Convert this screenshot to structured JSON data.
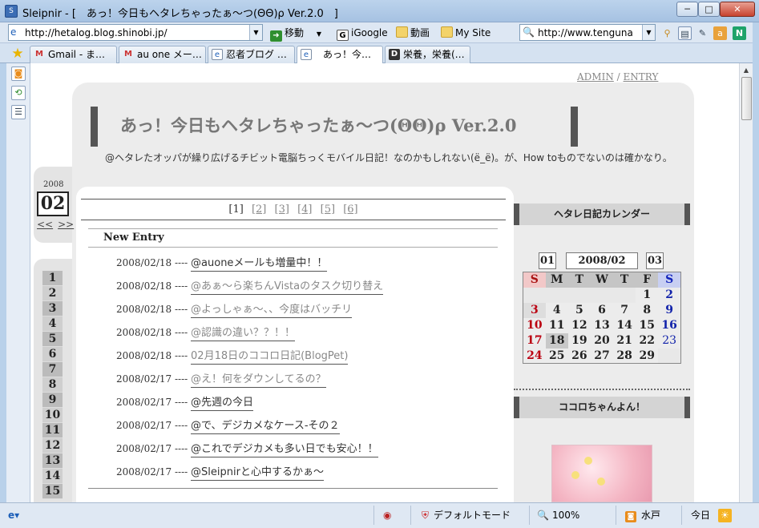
{
  "window": {
    "title": "Sleipnir - [　あっ！今日もヘタレちゃったぁ～つ(ΘΘ)ρ Ver.2.0　]",
    "min": "─",
    "max": "□",
    "close": "✕"
  },
  "toolbar": {
    "address": "http://hetalog.blog.shinobi.jp/",
    "go_label": "移動",
    "bookmarks": [
      "iGoogle",
      "動画",
      "My Site"
    ],
    "search_value": "http://www.tenguna"
  },
  "tabs": [
    {
      "label": "Gmail - ま…",
      "icon": "gmail-icon"
    },
    {
      "label": "au one メー…",
      "icon": "page-icon"
    },
    {
      "label": "忍者ブログ …",
      "icon": "page-icon"
    },
    {
      "label": "あっ！今…",
      "icon": "page-icon",
      "active": true
    },
    {
      "label": "栄養，栄養(…",
      "icon": "d-icon"
    }
  ],
  "page": {
    "admin": "ADMIN",
    "slash": "/",
    "entry": "ENTRY",
    "blog_title": "あっ！今日もヘタレちゃったぁ～つ(ΘΘ)ρ Ver.2.0",
    "blog_desc": "@ヘタレたオッパが繰り広げるチビット電脳ちっくモバイル日記！なのかもしれない(ё_ё)。が、How toものでないのは確かなり。",
    "date_year": "2008",
    "date_month": "02",
    "date_prev": "<<",
    "date_next": ">>",
    "days": [
      "1",
      "2",
      "3",
      "4",
      "5",
      "6",
      "7",
      "8",
      "9",
      "10",
      "11",
      "12",
      "13",
      "14",
      "15"
    ],
    "pager": [
      "[1]",
      "[2]",
      "[3]",
      "[4]",
      "[5]",
      "[6]"
    ],
    "new_entry_label": "New Entry",
    "entries": [
      {
        "date": "2008/02/18 ----",
        "title": "@auoneメールも増量中！！",
        "gray": false
      },
      {
        "date": "2008/02/18 ----",
        "title": "@あぁ～ら楽ちんVistaのタスク切り替え",
        "gray": true
      },
      {
        "date": "2008/02/18 ----",
        "title": "@よっしゃぁ～、、今度はバッチリ",
        "gray": true
      },
      {
        "date": "2008/02/18 ----",
        "title": "@認識の違い？？！！",
        "gray": true
      },
      {
        "date": "2008/02/18 ----",
        "title": "02月18日のココロ日記(BlogPet)",
        "gray": true
      },
      {
        "date": "2008/02/17 ----",
        "title": "@え！何をダウンしてるの？",
        "gray": true
      },
      {
        "date": "2008/02/17 ----",
        "title": "@先週の今日",
        "gray": false
      },
      {
        "date": "2008/02/17 ----",
        "title": "@で、デジカメなケース-その２",
        "gray": false
      },
      {
        "date": "2008/02/17 ----",
        "title": "@これでデジカメも多い日でも安心！！",
        "gray": false
      },
      {
        "date": "2008/02/17 ----",
        "title": "@Sleipnirと心中するかぁ～",
        "gray": false
      }
    ],
    "calendar_title": "ヘタレ日記カレンダー",
    "cal_prev": "01",
    "cal_month": "2008/02",
    "cal_next": "03",
    "cal_headers": [
      "S",
      "M",
      "T",
      "W",
      "T",
      "F",
      "S"
    ],
    "cal_rows": [
      [
        "",
        "",
        "",
        "",
        "",
        "1",
        "2"
      ],
      [
        "3",
        "4",
        "5",
        "6",
        "7",
        "8",
        "9"
      ],
      [
        "10",
        "11",
        "12",
        "13",
        "14",
        "15",
        "16"
      ],
      [
        "17",
        "18",
        "19",
        "20",
        "21",
        "22",
        "23"
      ],
      [
        "24",
        "25",
        "26",
        "27",
        "28",
        "29",
        ""
      ]
    ],
    "kokoro_title": "ココロちゃんよん！"
  },
  "status": {
    "mode": "デフォルトモード",
    "zoom": "100%",
    "location": "水戸",
    "today": "今日"
  }
}
